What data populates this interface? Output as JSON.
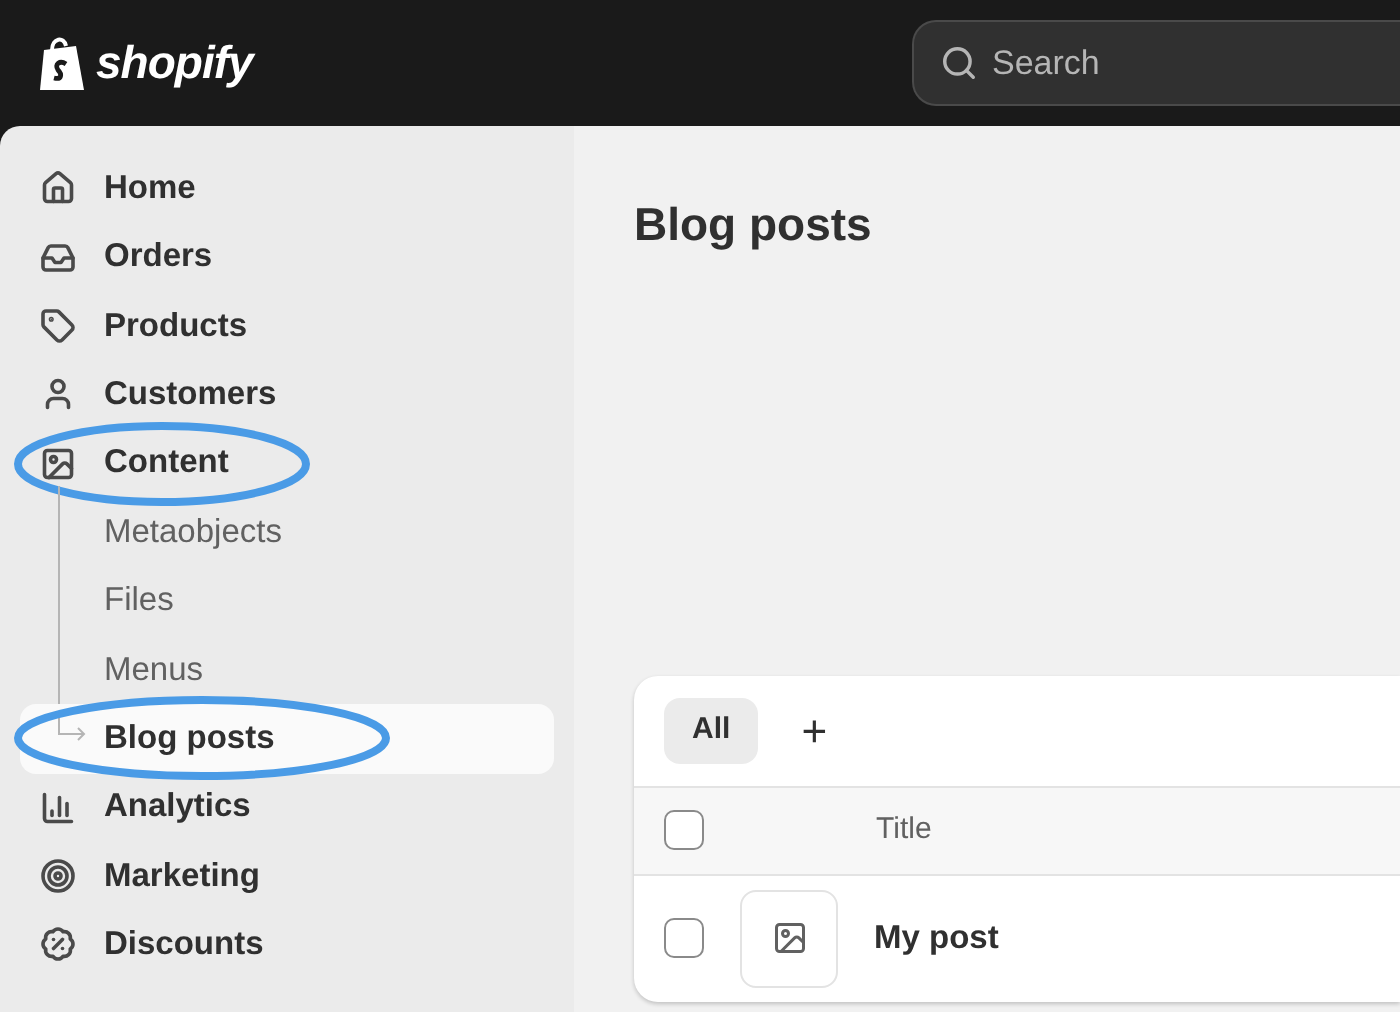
{
  "topbar": {
    "logo": "shopify",
    "search": {
      "placeholder": "Search"
    }
  },
  "sidebar": {
    "items": [
      {
        "label": "Home",
        "selected": false,
        "circled": false
      },
      {
        "label": "Orders",
        "selected": false,
        "circled": false
      },
      {
        "label": "Products",
        "selected": false,
        "circled": false
      },
      {
        "label": "Customers",
        "selected": false,
        "circled": false
      },
      {
        "label": "Content",
        "selected": false,
        "circled": true,
        "children": [
          {
            "label": "Metaobjects",
            "selected": false,
            "circled": false
          },
          {
            "label": "Files",
            "selected": false,
            "circled": false
          },
          {
            "label": "Menus",
            "selected": false,
            "circled": false
          },
          {
            "label": "Blog posts",
            "selected": true,
            "circled": true
          }
        ]
      },
      {
        "label": "Analytics",
        "selected": false,
        "circled": false
      },
      {
        "label": "Marketing",
        "selected": false,
        "circled": false
      },
      {
        "label": "Discounts",
        "selected": false,
        "circled": false
      }
    ]
  },
  "page": {
    "title": "Blog posts",
    "tabs": [
      {
        "label": "All",
        "selected": true
      }
    ],
    "add_tab": "+",
    "table": {
      "columns": [
        "Title"
      ],
      "header_checked": false,
      "rows": [
        {
          "title": "My post",
          "checked": false
        }
      ]
    }
  }
}
